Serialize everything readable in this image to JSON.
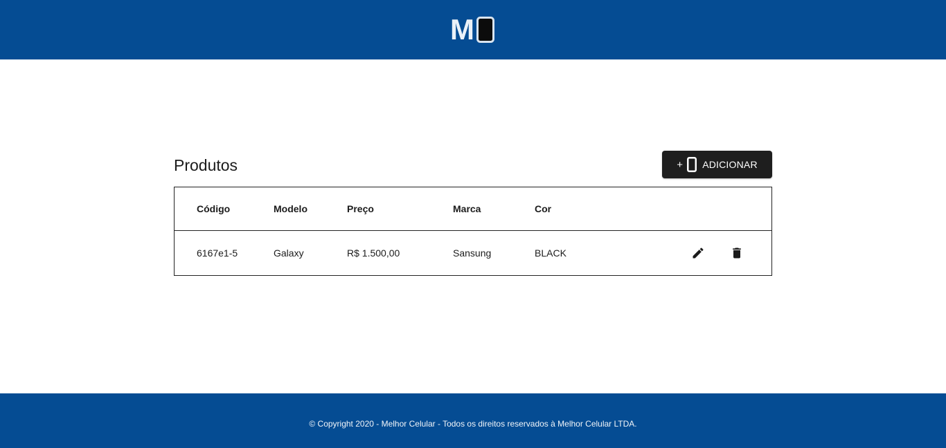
{
  "header": {
    "logo_text": "M",
    "logo_icon": "smartphone-icon",
    "background": "#054c93"
  },
  "main": {
    "title": "Produtos",
    "add_button": {
      "label": "ADICIONAR",
      "plus": "+",
      "icon": "smartphone-icon",
      "background": "#1e1e1e"
    },
    "table": {
      "columns": [
        "Código",
        "Modelo",
        "Preço",
        "Marca",
        "Cor"
      ],
      "rows": [
        {
          "code": "6167e1-5",
          "model": "Galaxy",
          "price": "R$ 1.500,00",
          "brand": "Sansung",
          "color": "BLACK",
          "actions": [
            "edit-icon",
            "delete-icon"
          ]
        }
      ]
    }
  },
  "footer": {
    "text": "© Copyright 2020 - Melhor Celular - Todos os direitos reservados à Melhor Celular LTDA.",
    "background": "#054c93"
  }
}
